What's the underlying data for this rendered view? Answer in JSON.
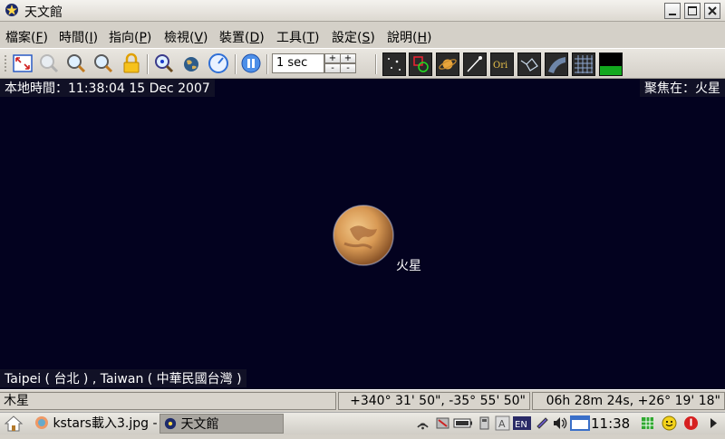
{
  "window": {
    "title": "天文館"
  },
  "menubar": {
    "items": [
      {
        "label": "檔案(",
        "key": "F",
        "tail": ")"
      },
      {
        "label": "時間(",
        "key": "I",
        "tail": ")"
      },
      {
        "label": "指向(",
        "key": "P",
        "tail": ")"
      },
      {
        "label": "檢視(",
        "key": "V",
        "tail": ")"
      },
      {
        "label": "裝置(",
        "key": "D",
        "tail": ")"
      },
      {
        "label": "工具(",
        "key": "T",
        "tail": ")"
      },
      {
        "label": "設定(",
        "key": "S",
        "tail": ")"
      },
      {
        "label": "說明(",
        "key": "H",
        "tail": ")"
      }
    ]
  },
  "toolbar": {
    "timestep_value": "1 sec",
    "spin_up": "+",
    "spin_down": "-",
    "display_buttons": [
      "stars-icon",
      "deep-sky-icon",
      "solar-system-icon",
      "comets-icon",
      "constellation-names-icon",
      "constellation-lines-icon",
      "milky-way-icon",
      "coordinate-grid-icon",
      "horizon-icon"
    ],
    "orion_label": "Ori"
  },
  "sky": {
    "local_time": "本地時間：11:38:04   15 Dec 2007",
    "focus": "聚焦在：火星",
    "planet_label": "火星",
    "location": "Taipei ( 台北 ) , Taiwan ( 中華民國台灣 )",
    "background": "#03021f"
  },
  "statusbar": {
    "object_name": "木星",
    "az_alt": "+340° 31' 50\",  -35° 55' 50\"",
    "ra_dec": "06h 28m 24s,  +26° 19' 18\""
  },
  "taskbar": {
    "tasks": [
      {
        "label": "kstars載入3.jpg -"
      },
      {
        "label": "天文館"
      }
    ],
    "clock": "11:38"
  }
}
